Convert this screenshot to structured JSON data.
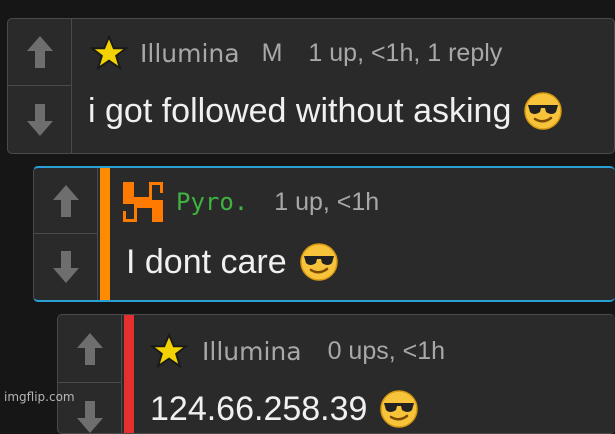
{
  "comments": [
    {
      "author": "Illumina",
      "badge": "M",
      "meta": "1 up, <1h, 1 reply",
      "text": "i got followed without asking",
      "avatar_icon": "star-icon",
      "emoji": "sunglasses-emoji"
    },
    {
      "author": "Pyro.",
      "badge": "",
      "meta": "1 up, <1h",
      "text": "I dont care",
      "avatar_icon": "orange-symbol-icon",
      "emoji": "sunglasses-emoji",
      "accent_color": "#ff8c00",
      "name_color": "#3fb23f"
    },
    {
      "author": "Illumina",
      "badge": "",
      "meta": "0 ups, <1h",
      "text": "124.66.258.39",
      "avatar_icon": "star-icon",
      "emoji": "sunglasses-emoji",
      "accent_color": "#e63030"
    }
  ],
  "watermark": "imgflip.com",
  "colors": {
    "background": "#161616",
    "card": "#2a2a2a",
    "selected_border": "#2a9fd6"
  }
}
